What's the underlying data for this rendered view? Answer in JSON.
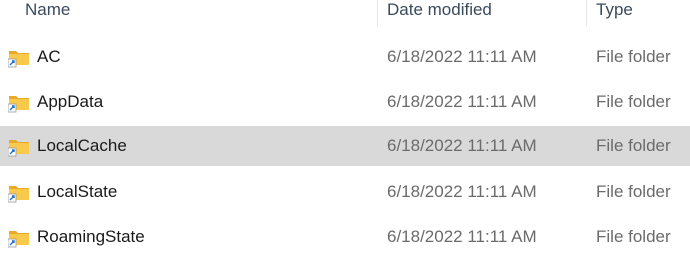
{
  "columns": {
    "name": "Name",
    "date_modified": "Date modified",
    "type": "Type"
  },
  "rows": [
    {
      "name": "AC",
      "date_modified": "6/18/2022 11:11 AM",
      "type": "File folder",
      "icon": "folder-shortcut-icon",
      "selected": false
    },
    {
      "name": "AppData",
      "date_modified": "6/18/2022 11:11 AM",
      "type": "File folder",
      "icon": "folder-shortcut-icon",
      "selected": false
    },
    {
      "name": "LocalCache",
      "date_modified": "6/18/2022 11:11 AM",
      "type": "File folder",
      "icon": "folder-shortcut-icon",
      "selected": true
    },
    {
      "name": "LocalState",
      "date_modified": "6/18/2022 11:11 AM",
      "type": "File folder",
      "icon": "folder-shortcut-icon",
      "selected": false
    },
    {
      "name": "RoamingState",
      "date_modified": "6/18/2022 11:11 AM",
      "type": "File folder",
      "icon": "folder-shortcut-icon",
      "selected": false
    }
  ],
  "colors": {
    "selected_row": "#d9d9d9",
    "folder_body": "#f8c94a",
    "folder_tab": "#e6a92a",
    "shortcut_arrow": "#1e6fd0"
  }
}
